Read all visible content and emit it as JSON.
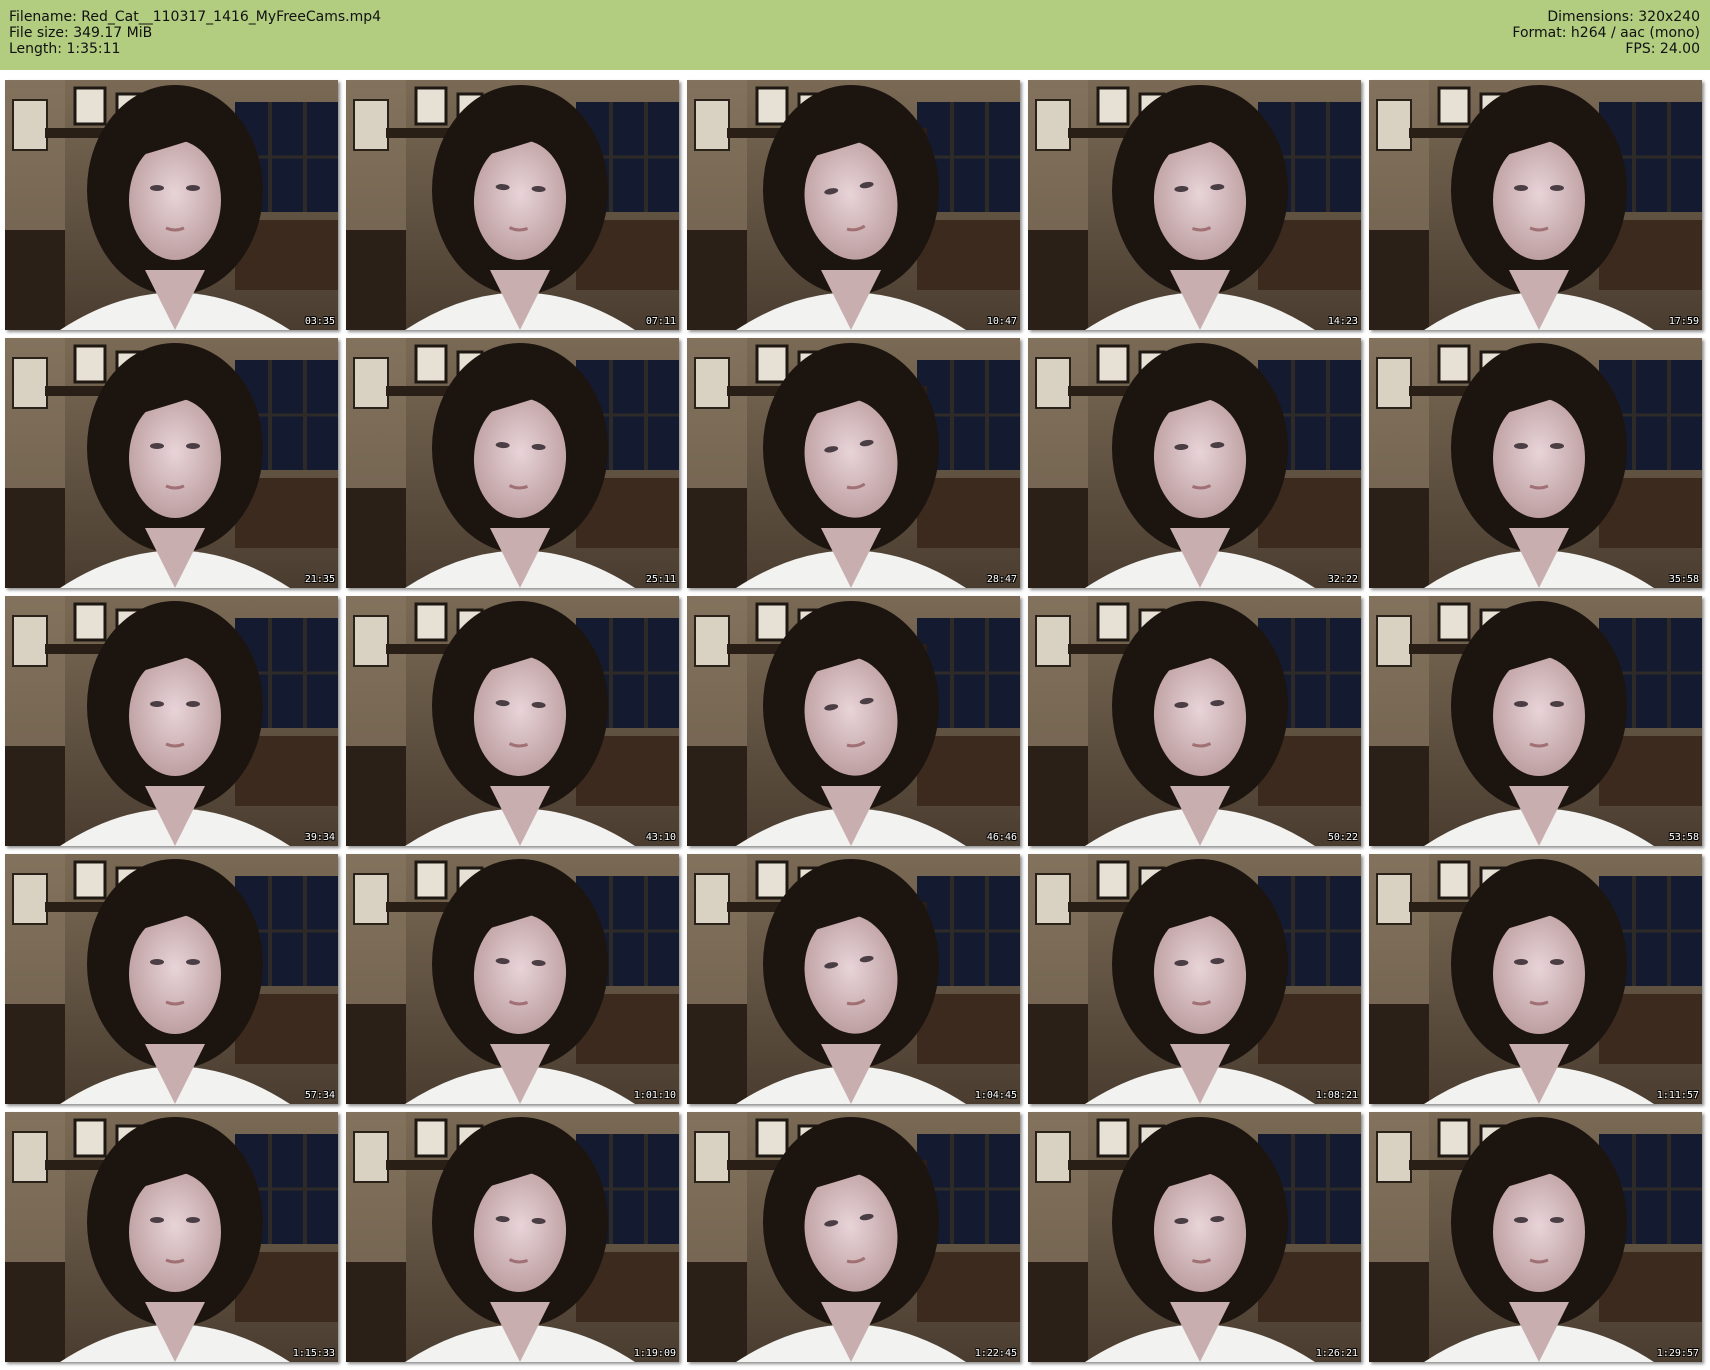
{
  "header": {
    "filename": "Filename: Red_Cat__110317_1416_MyFreeCams.mp4",
    "file_size": "File size: 349.17 MiB",
    "length": "Length: 1:35:11",
    "dimensions": "Dimensions: 320x240",
    "format": "Format: h264 / aac (mono)",
    "fps": "FPS: 24.00"
  },
  "colors": {
    "header_bg": "#b2cc80"
  },
  "thumbnails": [
    {
      "timestamp": "03:35"
    },
    {
      "timestamp": "07:11"
    },
    {
      "timestamp": "10:47"
    },
    {
      "timestamp": "14:23"
    },
    {
      "timestamp": "17:59"
    },
    {
      "timestamp": "21:35"
    },
    {
      "timestamp": "25:11"
    },
    {
      "timestamp": "28:47"
    },
    {
      "timestamp": "32:22"
    },
    {
      "timestamp": "35:58"
    },
    {
      "timestamp": "39:34"
    },
    {
      "timestamp": "43:10"
    },
    {
      "timestamp": "46:46"
    },
    {
      "timestamp": "50:22"
    },
    {
      "timestamp": "53:58"
    },
    {
      "timestamp": "57:34"
    },
    {
      "timestamp": "1:01:10"
    },
    {
      "timestamp": "1:04:45"
    },
    {
      "timestamp": "1:08:21"
    },
    {
      "timestamp": "1:11:57"
    },
    {
      "timestamp": "1:15:33"
    },
    {
      "timestamp": "1:19:09"
    },
    {
      "timestamp": "1:22:45"
    },
    {
      "timestamp": "1:26:21"
    },
    {
      "timestamp": "1:29:57"
    }
  ]
}
